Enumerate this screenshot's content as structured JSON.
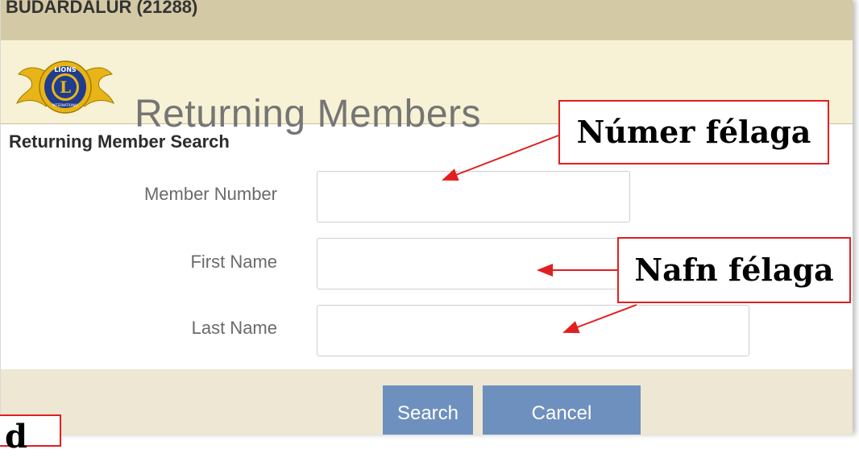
{
  "header": {
    "club_name": "BUDARDALUR (21288)",
    "page_title": "Returning Members"
  },
  "logo": {
    "top_text": "LIONS",
    "letter": "L",
    "bottom_text": "INTERNATIONAL"
  },
  "search": {
    "section_label": "Returning Member Search",
    "fields": [
      {
        "label": "Member Number",
        "value": ""
      },
      {
        "label": "First Name",
        "value": ""
      },
      {
        "label": "Last Name",
        "value": ""
      }
    ],
    "search_label": "Search",
    "cancel_label": "Cancel"
  },
  "annotations": {
    "member_number_callout": "Númer félaga",
    "name_callout": "Nafn félaga",
    "bottom_callout": "d"
  },
  "colors": {
    "club_bar": "#d3c9a4",
    "header_band": "#f7f2d5",
    "button": "#6e90bf",
    "callout_border": "#e02020",
    "logo_gold": "#e8b417",
    "logo_blue": "#1f3c8f"
  }
}
